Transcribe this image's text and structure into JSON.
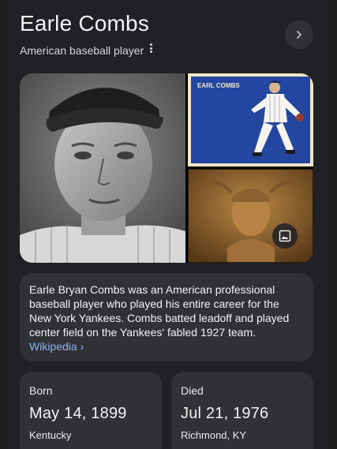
{
  "header": {
    "title": "Earle Combs",
    "subtitle": "American baseball player",
    "next_icon": "chevron-right-icon",
    "more_icon": "more-vertical-icon"
  },
  "gallery": {
    "card_caption": "EARL COMBS",
    "images_icon": "image-icon"
  },
  "description": {
    "text": "Earle Bryan Combs was an American professional baseball player who played his entire career for the New York Yankees. Combs batted leadoff and played center field on the Yankees' fabled 1927 team.",
    "source_link": "Wikipedia ›"
  },
  "facts": [
    {
      "label": "Born",
      "date": "May 14, 1899",
      "place": "Kentucky"
    },
    {
      "label": "Died",
      "date": "Jul 21, 1976",
      "place": "Richmond, KY"
    }
  ],
  "colors": {
    "background": "#202124",
    "card": "#303134",
    "link": "#8ab4f8"
  }
}
